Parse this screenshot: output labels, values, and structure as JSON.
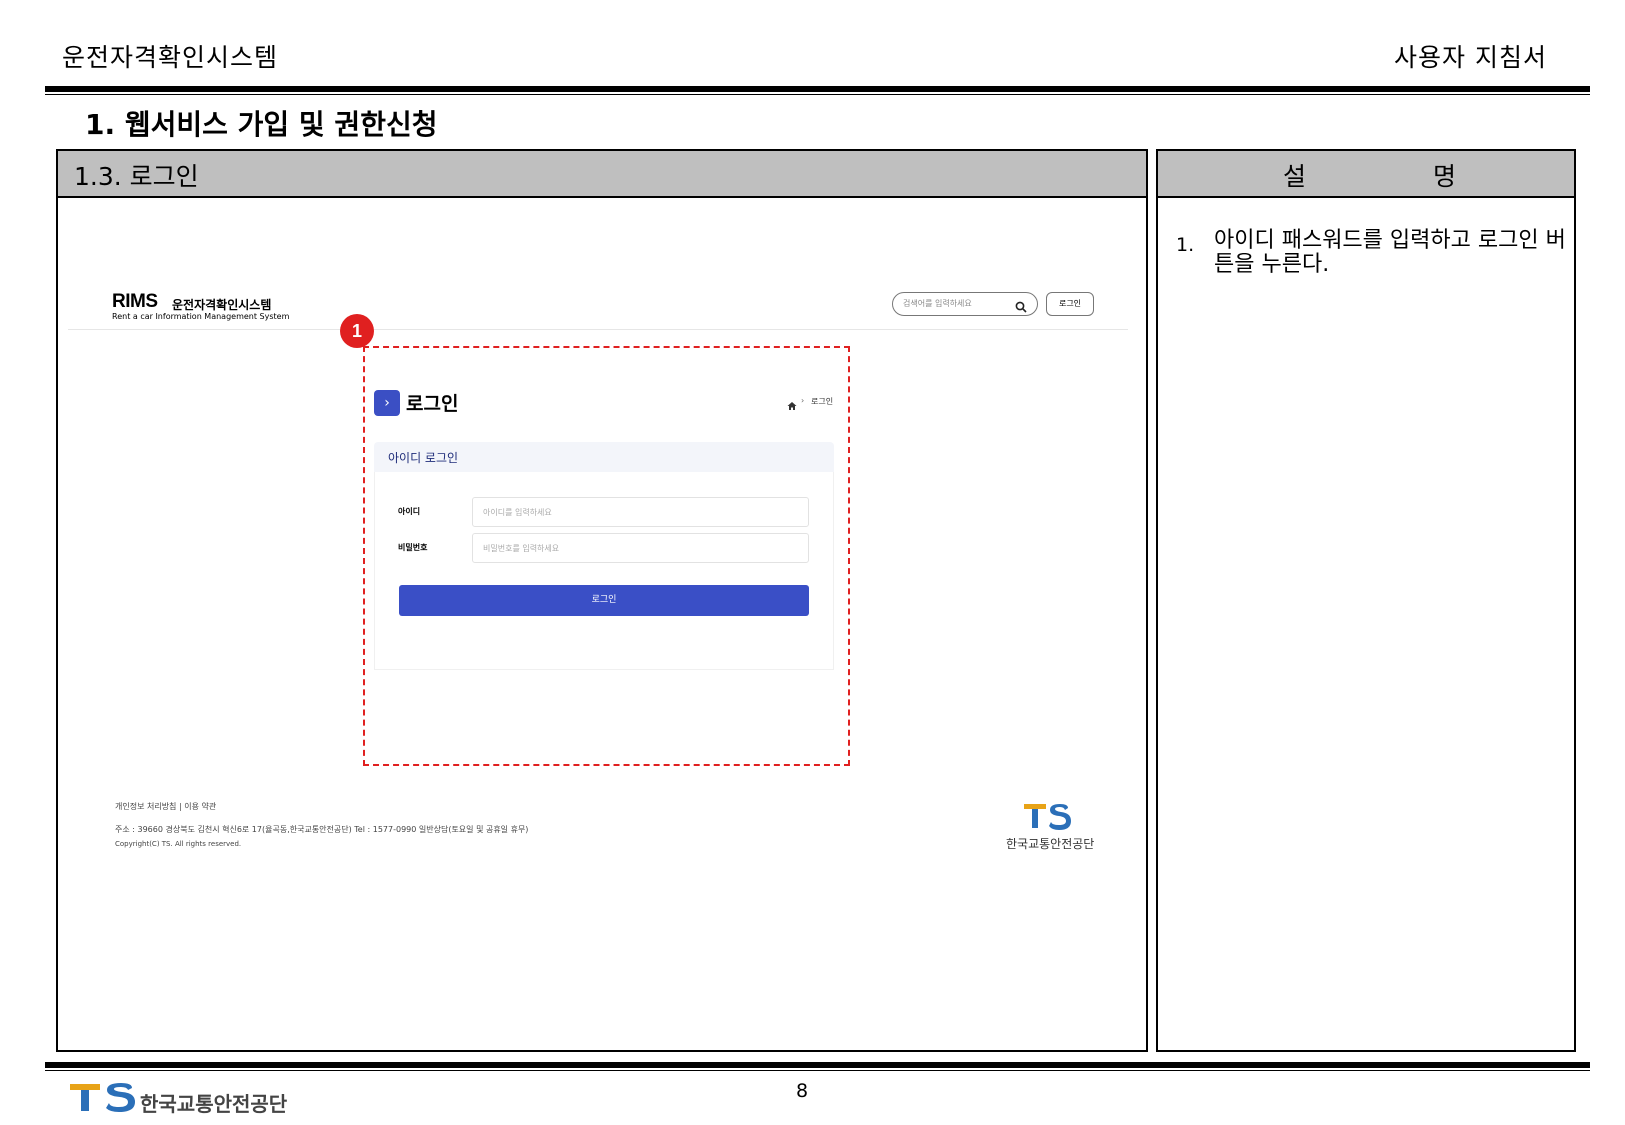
{
  "header": {
    "left": "운전자격확인시스템",
    "right": "사용자 지침서"
  },
  "section_title": "1. 웹서비스 가입 및 권한신청",
  "left_panel": {
    "title": "1.3. 로그인"
  },
  "right_panel": {
    "title_a": "설",
    "title_b": "명",
    "items": [
      {
        "num": "1.",
        "text": "아이디 패스워드를 입력하고 로그인 버튼을 누른다."
      }
    ]
  },
  "screenshot": {
    "logo_text": "RIMS",
    "logo_kr": "운전자격확인시스템",
    "logo_sub": "Rent a car Information Management System",
    "search_placeholder": "검색어를 입력하세요",
    "top_login": "로그인",
    "marker": "1",
    "page_title": "로그인",
    "breadcrumb": "로그인",
    "card_title": "아이디 로그인",
    "id_label": "아이디",
    "id_placeholder": "아이디를 입력하세요",
    "pw_label": "비밀번호",
    "pw_placeholder": "비밀번호를 입력하세요",
    "login_button": "로그인",
    "footer_links": "개인정보 처리방침  |  이용 약관",
    "footer_address": "주소 : 39660 경상북도 김천시 혁신6로 17(율곡동,한국교통안전공단)    Tel : 1577-0990    일반상담(토요일 및 공휴일 휴무)",
    "footer_copyright": "Copyright(C) TS. All rights reserved.",
    "ts_name": "한국교통안전공단"
  },
  "footer": {
    "page_number": "8",
    "org_name": "한국교통안전공단"
  },
  "colors": {
    "accent_blue": "#3a4fc6",
    "marker_red": "#e02020",
    "ts_blue": "#2b6fb8",
    "ts_gold": "#e8a317"
  }
}
